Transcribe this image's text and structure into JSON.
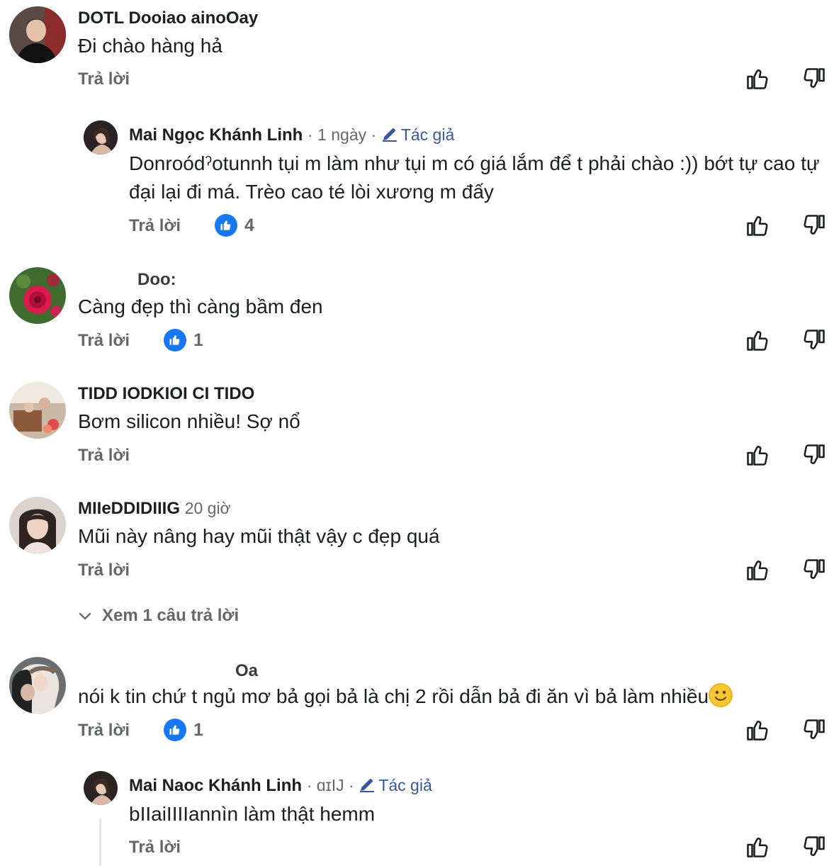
{
  "comments": [
    {
      "author": "DOTL Dooiao ainoOay",
      "text": "Đi chào hàng hả",
      "reply_label": "Trả lời"
    },
    {
      "author": "Mai Ngọc Khánh Linh",
      "time": "· 1 ngày ·",
      "badge": "Tác giả",
      "text": "Donroódˀotunnh tụi m làm như tụi m có giá lắm để t phải chào :)) bớt tự cao tự đại lại đi má. Trèo cao té lòi xương m đấy",
      "reply_label": "Trả lời",
      "like_count": "4"
    },
    {
      "author": "Doo:",
      "text": "Càng đẹp thì càng bầm đen",
      "reply_label": "Trả lời",
      "like_count": "1"
    },
    {
      "author": "TIDD IODKIOI CI TIDO",
      "text": "Bơm silicon nhiều! Sợ nổ",
      "reply_label": "Trả lời"
    },
    {
      "author": "MIIeDDIDIIIG",
      "time": "20 giờ",
      "text": "Mũi này nâng hay mũi thật vậy c đẹp quá",
      "reply_label": "Trả lời",
      "view_replies": "Xem 1 câu trả lời"
    },
    {
      "author": "Oa",
      "text": "nói k tin chứ t ngủ mơ bả gọi bả là chị 2 rồi dẫn bả đi ăn vì bả làm nhiều",
      "reply_label": "Trả lời",
      "like_count": "1"
    },
    {
      "author": "Mai Naoc Khánh Linh",
      "time": "· ɑɪIJ ·",
      "badge": "Tác giả",
      "text": "bIIaiIIIIannìn làm thật hemm",
      "reply_label": "Trả lời"
    }
  ],
  "colors": {
    "like_blue": "#1877f2",
    "author_badge": "#385898",
    "secondary_text": "#65676b"
  },
  "icons": {
    "thumbs_up": "thumbs-up-icon",
    "thumbs_down": "thumbs-down-icon",
    "pencil": "pencil-icon",
    "chevron": "chevron-down-icon",
    "emoji": "slightly-smiling-emoji"
  }
}
